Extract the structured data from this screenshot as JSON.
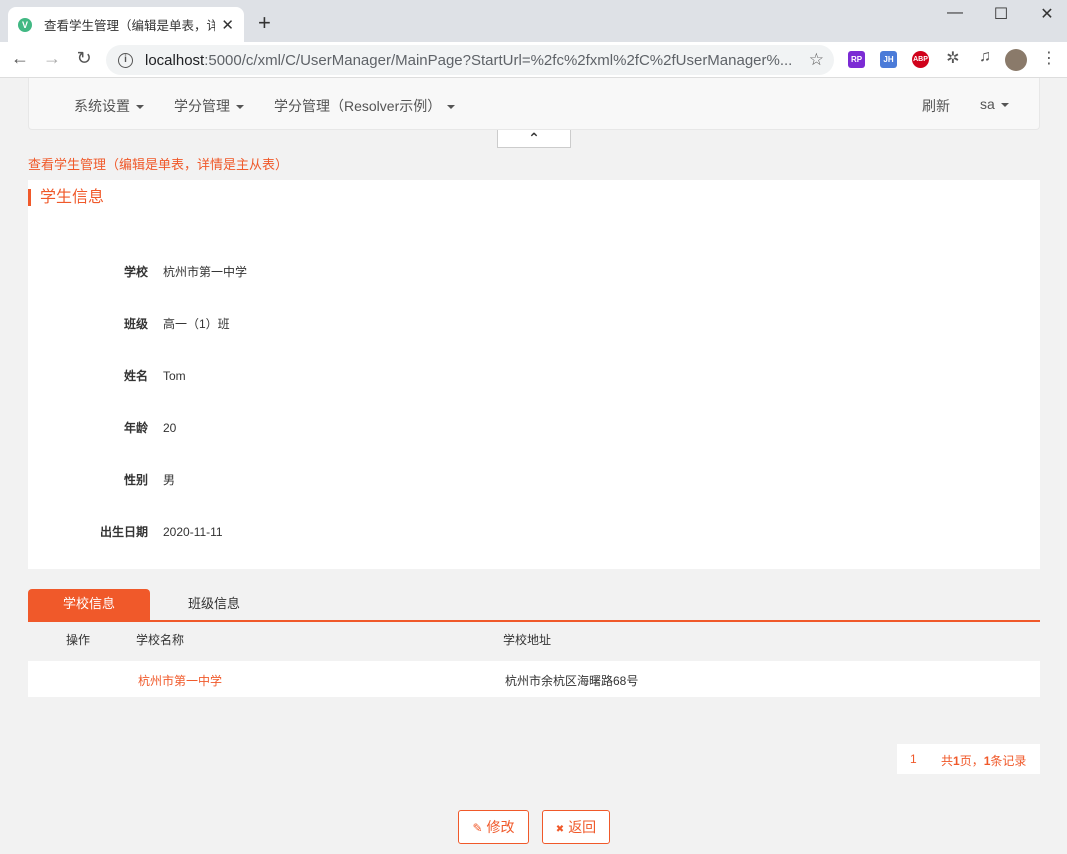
{
  "browser": {
    "tab_title": "查看学生管理（编辑是单表，详情是主从表）",
    "tab_favicon": "V",
    "new_tab": "+",
    "close": "✕",
    "minimize": "—",
    "maximize": "☐",
    "url_host": "localhost",
    "url_rest": ":5000/c/xml/C/UserManager/MainPage?StartUrl=%2fc%2fxml%2fC%2fUserManager%...",
    "extensions": [
      "RP",
      "JH",
      "ABP"
    ]
  },
  "nav": {
    "items": [
      "系统设置",
      "学分管理",
      "学分管理（Resolver示例）"
    ],
    "refresh": "刷新",
    "user": "sa",
    "collapse_icon": "⌃"
  },
  "page_title": "查看学生管理（编辑是单表，详情是主从表）",
  "card": {
    "title": "学生信息",
    "fields": [
      {
        "label": "学校",
        "value": "杭州市第一中学"
      },
      {
        "label": "班级",
        "value": "高一（1）班"
      },
      {
        "label": "姓名",
        "value": "Tom"
      },
      {
        "label": "年龄",
        "value": "20"
      },
      {
        "label": "性别",
        "value": "男"
      },
      {
        "label": "出生日期",
        "value": "2020-11-11"
      }
    ]
  },
  "tabs": [
    {
      "label": "学校信息",
      "active": true
    },
    {
      "label": "班级信息",
      "active": false
    }
  ],
  "table": {
    "headers": [
      "操作",
      "学校名称",
      "学校地址"
    ],
    "rows": [
      {
        "name": "杭州市第一中学",
        "address": "杭州市余杭区海曙路68号"
      }
    ]
  },
  "pager": {
    "page": "1",
    "summary_prefix": "共",
    "pages": "1",
    "summary_mid": "页，",
    "records": "1",
    "summary_suffix": "条记录"
  },
  "buttons": {
    "edit_icon": "✎",
    "edit": "修改",
    "back_icon": "✖",
    "back": "返回"
  },
  "colors": {
    "accent": "#f0592a"
  }
}
